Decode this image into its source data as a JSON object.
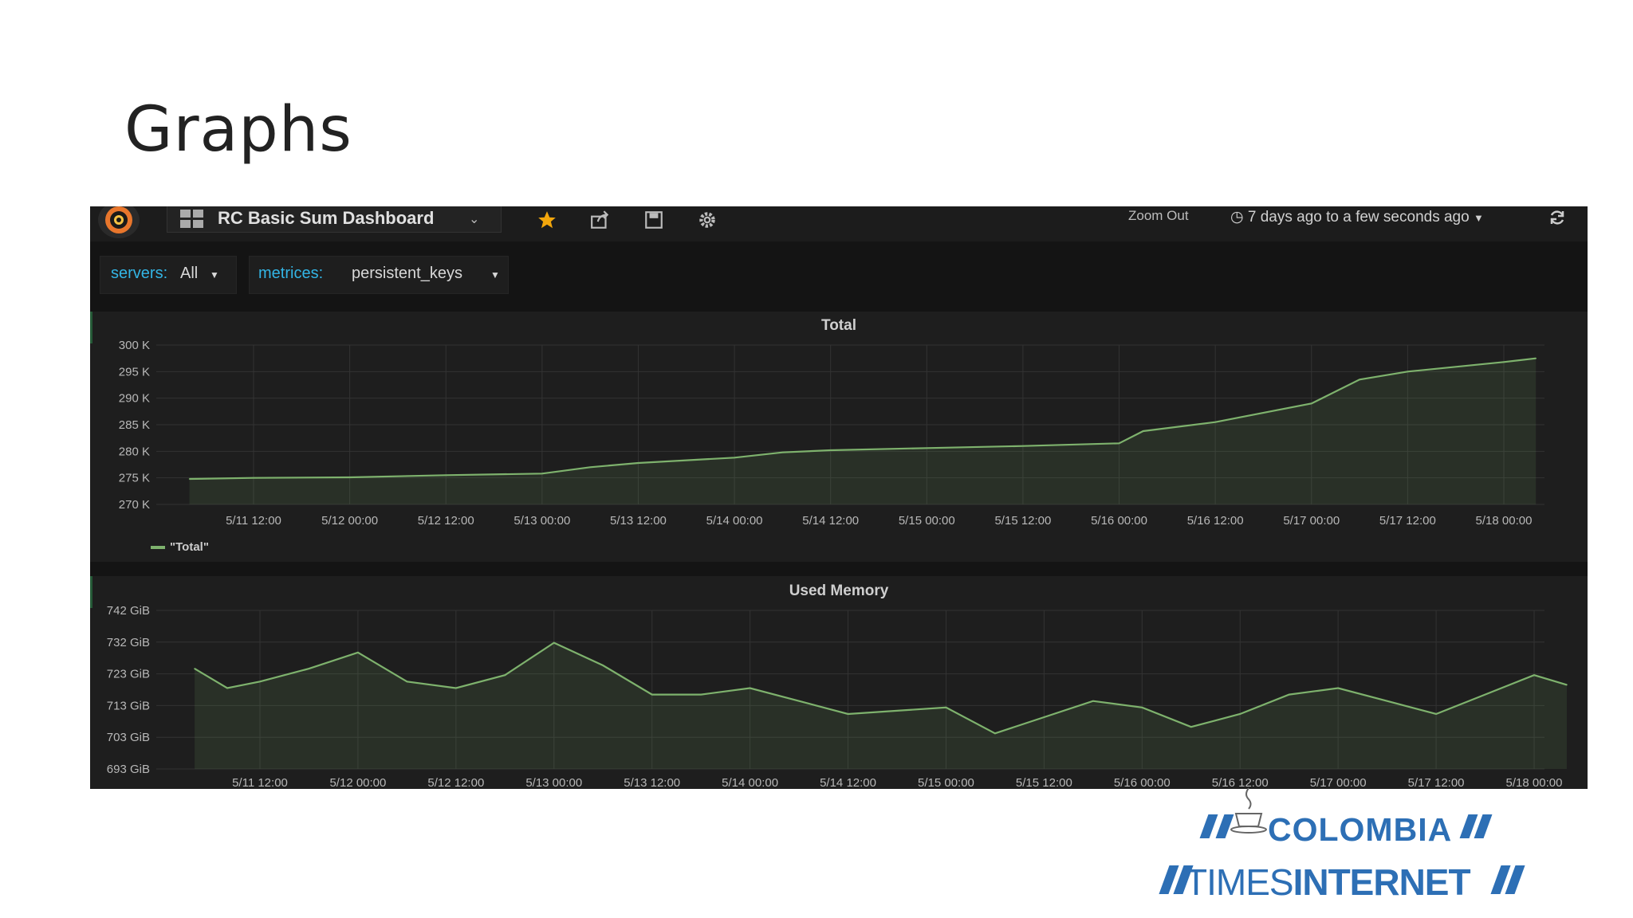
{
  "slide": {
    "title": "Graphs"
  },
  "toolbar": {
    "dashboard_title": "RC Basic Sum Dashboard",
    "zoom_out": "Zoom Out",
    "time_range": "7 days ago to a few seconds ago",
    "icons": [
      "grafana-logo-icon",
      "dashboard-grid-icon",
      "star-icon",
      "share-icon",
      "save-icon",
      "gear-icon",
      "clock-icon",
      "refresh-icon"
    ],
    "star_color": "#f2a60c"
  },
  "templating": {
    "servers": {
      "label": "servers:",
      "value": "All"
    },
    "metrices": {
      "label": "metrices:",
      "value": "persistent_keys"
    }
  },
  "colors": {
    "accent_blue": "#33b5e5",
    "series_green": "#7eb26d",
    "background": "#141414"
  },
  "chart_data": [
    {
      "type": "line",
      "title": "Total",
      "x_ticks": [
        "5/11 12:00",
        "5/12 00:00",
        "5/12 12:00",
        "5/13 00:00",
        "5/13 12:00",
        "5/14 00:00",
        "5/14 12:00",
        "5/15 00:00",
        "5/15 12:00",
        "5/16 00:00",
        "5/16 12:00",
        "5/17 00:00",
        "5/17 12:00",
        "5/18 00:00"
      ],
      "y_ticks": [
        "300 K",
        "295 K",
        "290 K",
        "285 K",
        "280 K",
        "275 K",
        "270 K"
      ],
      "ylim": [
        270,
        300
      ],
      "y_unit": "K",
      "x": [
        "5/11 04:00",
        "5/11 12:00",
        "5/12 00:00",
        "5/12 12:00",
        "5/13 00:00",
        "5/13 06:00",
        "5/13 12:00",
        "5/14 00:00",
        "5/14 06:00",
        "5/14 12:00",
        "5/15 00:00",
        "5/15 12:00",
        "5/16 00:00",
        "5/16 03:00",
        "5/16 12:00",
        "5/17 00:00",
        "5/17 06:00",
        "5/17 12:00",
        "5/18 00:00",
        "5/18 04:00"
      ],
      "series": [
        {
          "name": "\"Total\"",
          "values": [
            274.8,
            275.0,
            275.1,
            275.5,
            275.8,
            277.0,
            277.8,
            278.8,
            279.8,
            280.2,
            280.6,
            281.0,
            281.5,
            283.8,
            285.5,
            289.0,
            293.5,
            295.0,
            296.8,
            297.5
          ]
        }
      ],
      "legend": "bottom-left",
      "grid": true
    },
    {
      "type": "area",
      "title": "Used Memory",
      "x_ticks": [
        "5/11 12:00",
        "5/12 00:00",
        "5/12 12:00",
        "5/13 00:00",
        "5/13 12:00",
        "5/14 00:00",
        "5/14 12:00",
        "5/15 00:00",
        "5/15 12:00",
        "5/16 00:00",
        "5/16 12:00",
        "5/17 00:00",
        "5/17 12:00",
        "5/18 00:00"
      ],
      "y_ticks": [
        "742 GiB",
        "732 GiB",
        "723 GiB",
        "713 GiB",
        "703 GiB",
        "693 GiB"
      ],
      "ylim": [
        693,
        742
      ],
      "y_unit": "GiB",
      "x": [
        "5/11 04:00",
        "5/11 08:00",
        "5/11 12:00",
        "5/11 18:00",
        "5/12 00:00",
        "5/12 06:00",
        "5/12 12:00",
        "5/12 18:00",
        "5/13 00:00",
        "5/13 06:00",
        "5/13 12:00",
        "5/13 18:00",
        "5/14 00:00",
        "5/14 06:00",
        "5/14 12:00",
        "5/14 18:00",
        "5/15 00:00",
        "5/15 06:00",
        "5/15 12:00",
        "5/15 18:00",
        "5/16 00:00",
        "5/16 06:00",
        "5/16 12:00",
        "5/16 18:00",
        "5/17 00:00",
        "5/17 06:00",
        "5/17 12:00",
        "5/17 18:00",
        "5/18 00:00",
        "5/18 04:00"
      ],
      "series": [
        {
          "name": "Used Memory",
          "values": [
            724,
            718,
            720,
            724,
            729,
            720,
            718,
            722,
            732,
            725,
            716,
            716,
            718,
            714,
            710,
            711,
            712,
            704,
            709,
            714,
            712,
            706,
            710,
            716,
            718,
            714,
            710,
            716,
            722,
            719
          ]
        }
      ],
      "grid": true
    }
  ],
  "branding": {
    "line1": "COLOMBIA",
    "line2a": "TIMES",
    "line2b": "INTERNET"
  }
}
